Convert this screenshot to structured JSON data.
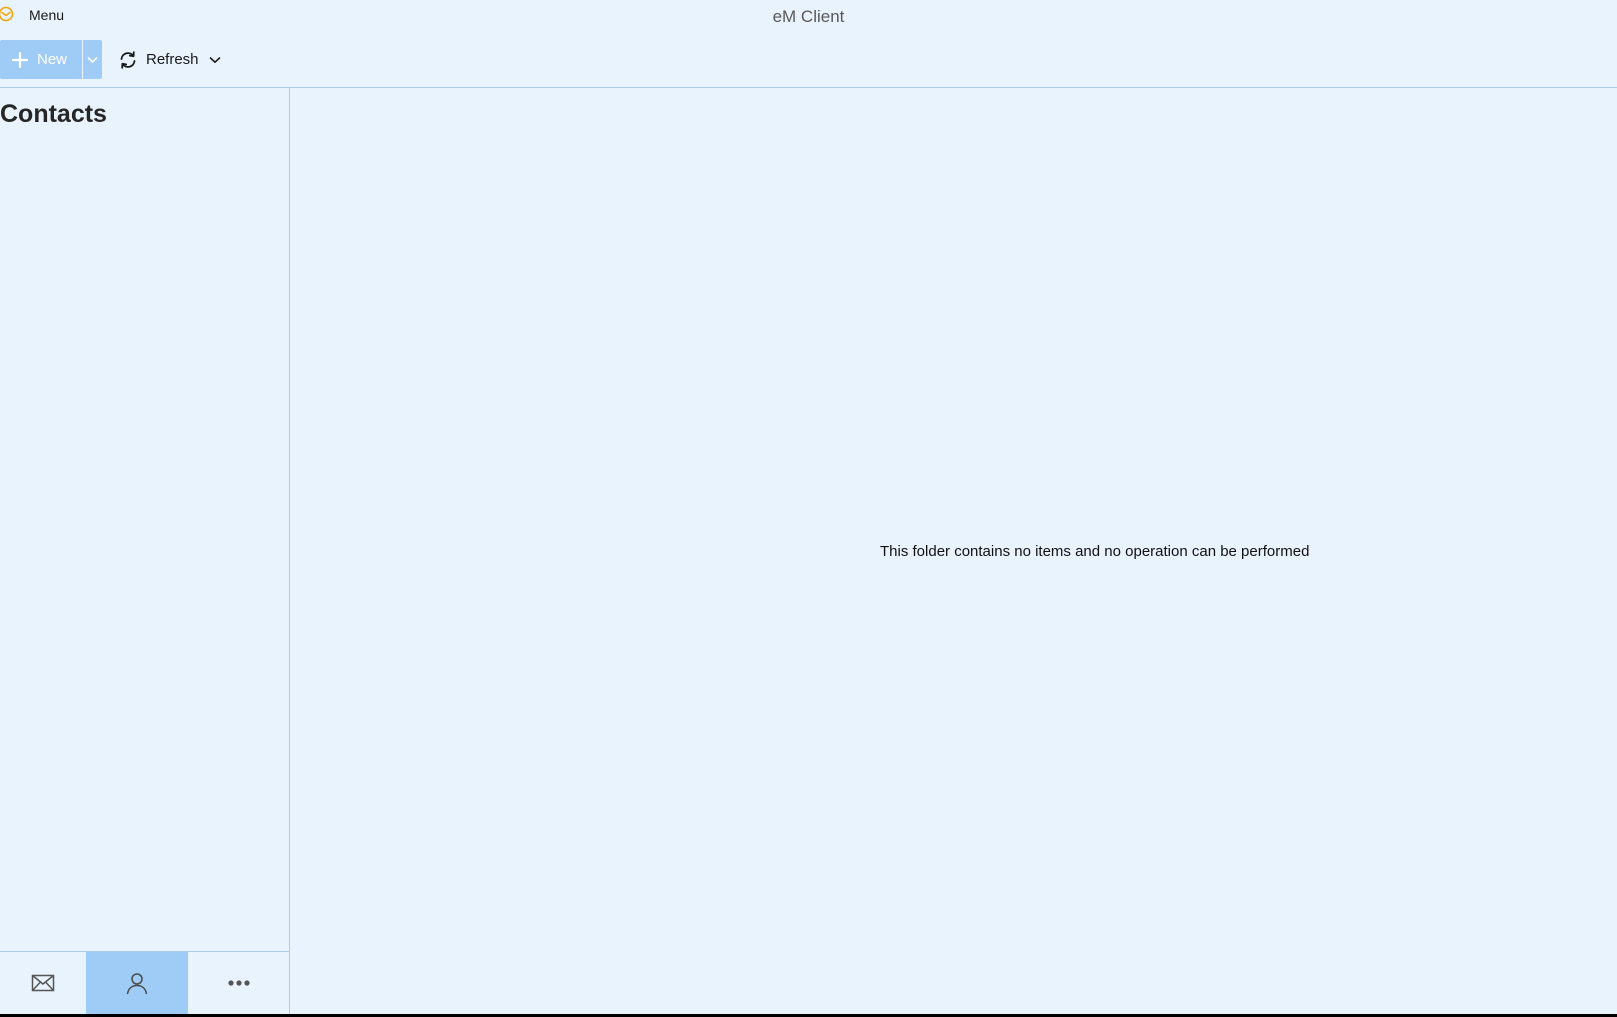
{
  "app": {
    "title": "eM Client",
    "menu_label": "Menu",
    "accent_color": "#9fccf7",
    "logo_color": "#f0a30a"
  },
  "toolbar": {
    "new_label": "New",
    "refresh_label": "Refresh"
  },
  "sidebar": {
    "title": "Contacts",
    "nav": [
      {
        "icon": "mail-icon",
        "active": false
      },
      {
        "icon": "person-icon",
        "active": true
      },
      {
        "icon": "more-icon",
        "active": false
      }
    ]
  },
  "main": {
    "empty_message": "This folder contains no items and no operation can be performed"
  }
}
